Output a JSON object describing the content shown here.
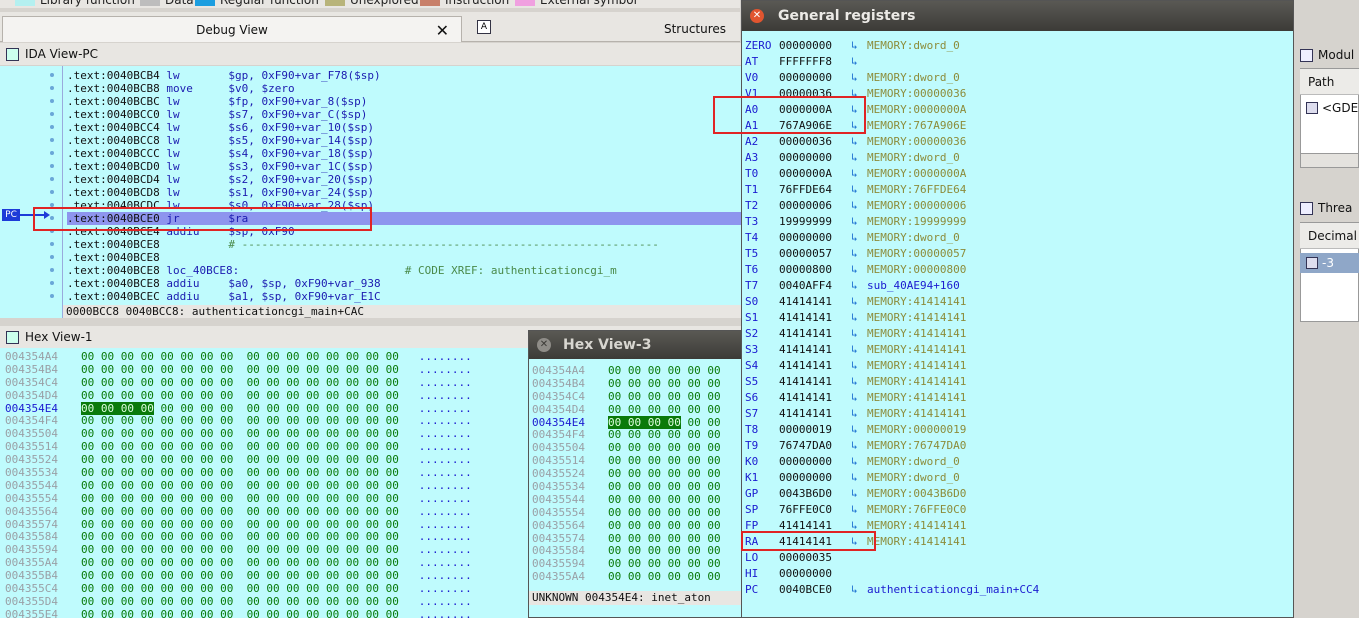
{
  "legend": [
    {
      "label": "Library function",
      "color": "#b4f0f0"
    },
    {
      "label": "Data",
      "color": "#bdbdbd"
    },
    {
      "label": "Regular function",
      "color": "#1c9ee0"
    },
    {
      "label": "Unexplored",
      "color": "#b8b47a"
    },
    {
      "label": "Instruction",
      "color": "#c8806a"
    },
    {
      "label": "External symbol",
      "color": "#f0a0e0"
    }
  ],
  "tabs": {
    "debug_view": "Debug View",
    "structures": "Structures",
    "structures_icon": "A"
  },
  "ida": {
    "title": "IDA View-PC",
    "pc_label": "PC",
    "lines": [
      {
        "addr": ".text:0040BCB4",
        "mn": "lw",
        "op": "$gp, 0xF90+var_F78($sp)"
      },
      {
        "addr": ".text:0040BCB8",
        "mn": "move",
        "op": "$v0, $zero"
      },
      {
        "addr": ".text:0040BCBC",
        "mn": "lw",
        "op": "$fp, 0xF90+var_8($sp)"
      },
      {
        "addr": ".text:0040BCC0",
        "mn": "lw",
        "op": "$s7, 0xF90+var_C($sp)"
      },
      {
        "addr": ".text:0040BCC4",
        "mn": "lw",
        "op": "$s6, 0xF90+var_10($sp)"
      },
      {
        "addr": ".text:0040BCC8",
        "mn": "lw",
        "op": "$s5, 0xF90+var_14($sp)"
      },
      {
        "addr": ".text:0040BCCC",
        "mn": "lw",
        "op": "$s4, 0xF90+var_18($sp)"
      },
      {
        "addr": ".text:0040BCD0",
        "mn": "lw",
        "op": "$s3, 0xF90+var_1C($sp)"
      },
      {
        "addr": ".text:0040BCD4",
        "mn": "lw",
        "op": "$s2, 0xF90+var_20($sp)"
      },
      {
        "addr": ".text:0040BCD8",
        "mn": "lw",
        "op": "$s1, 0xF90+var_24($sp)"
      },
      {
        "addr": ".text:0040BCDC",
        "mn": "lw",
        "op": "$s0, 0xF90+var_28($sp)"
      },
      {
        "addr": ".text:0040BCE0",
        "mn": "jr",
        "op": "$ra"
      },
      {
        "addr": ".text:0040BCE4",
        "mn": "addiu",
        "op": "$sp, 0xF90"
      },
      {
        "addr": ".text:0040BCE8",
        "mn": "",
        "op": "# ---------------------------------------------------------------"
      },
      {
        "addr": ".text:0040BCE8",
        "mn": "",
        "op": ""
      },
      {
        "addr": ".text:0040BCE8",
        "mn": "loc_40BCE8:",
        "op": "                         # CODE XREF: authenticationcgi_m"
      },
      {
        "addr": ".text:0040BCE8",
        "mn": "addiu",
        "op": "$a0, $sp, 0xF90+var_938"
      },
      {
        "addr": ".text:0040BCEC",
        "mn": "addiu",
        "op": "$a1, $sp, 0xF90+var_E1C"
      }
    ],
    "status": "0000BCC8 0040BCC8: authenticationcgi_main+CAC"
  },
  "hex1": {
    "title": "Hex View-1",
    "rows": [
      {
        "addr": "004354A4",
        "bytes": "00 00 00 00 00 00 00 00  00 00 00 00 00 00 00 00",
        "ascii": "........"
      },
      {
        "addr": "004354B4",
        "bytes": "00 00 00 00 00 00 00 00  00 00 00 00 00 00 00 00",
        "ascii": "........"
      },
      {
        "addr": "004354C4",
        "bytes": "00 00 00 00 00 00 00 00  00 00 00 00 00 00 00 00",
        "ascii": "........"
      },
      {
        "addr": "004354D4",
        "bytes": "00 00 00 00 00 00 00 00  00 00 00 00 00 00 00 00",
        "ascii": "........"
      },
      {
        "addr": "004354E4",
        "sel": "00 00 00 00",
        "bytes": " 00 00 00 00  00 00 00 00 00 00 00 00",
        "ascii": "........",
        "current": true
      },
      {
        "addr": "004354F4",
        "bytes": "00 00 00 00 00 00 00 00  00 00 00 00 00 00 00 00",
        "ascii": "........"
      },
      {
        "addr": "00435504",
        "bytes": "00 00 00 00 00 00 00 00  00 00 00 00 00 00 00 00",
        "ascii": "........"
      },
      {
        "addr": "00435514",
        "bytes": "00 00 00 00 00 00 00 00  00 00 00 00 00 00 00 00",
        "ascii": "........"
      },
      {
        "addr": "00435524",
        "bytes": "00 00 00 00 00 00 00 00  00 00 00 00 00 00 00 00",
        "ascii": "........"
      },
      {
        "addr": "00435534",
        "bytes": "00 00 00 00 00 00 00 00  00 00 00 00 00 00 00 00",
        "ascii": "........"
      },
      {
        "addr": "00435544",
        "bytes": "00 00 00 00 00 00 00 00  00 00 00 00 00 00 00 00",
        "ascii": "........"
      },
      {
        "addr": "00435554",
        "bytes": "00 00 00 00 00 00 00 00  00 00 00 00 00 00 00 00",
        "ascii": "........"
      },
      {
        "addr": "00435564",
        "bytes": "00 00 00 00 00 00 00 00  00 00 00 00 00 00 00 00",
        "ascii": "........"
      },
      {
        "addr": "00435574",
        "bytes": "00 00 00 00 00 00 00 00  00 00 00 00 00 00 00 00",
        "ascii": "........"
      },
      {
        "addr": "00435584",
        "bytes": "00 00 00 00 00 00 00 00  00 00 00 00 00 00 00 00",
        "ascii": "........"
      },
      {
        "addr": "00435594",
        "bytes": "00 00 00 00 00 00 00 00  00 00 00 00 00 00 00 00",
        "ascii": "........"
      },
      {
        "addr": "004355A4",
        "bytes": "00 00 00 00 00 00 00 00  00 00 00 00 00 00 00 00",
        "ascii": "........"
      },
      {
        "addr": "004355B4",
        "bytes": "00 00 00 00 00 00 00 00  00 00 00 00 00 00 00 00",
        "ascii": "........"
      },
      {
        "addr": "004355C4",
        "bytes": "00 00 00 00 00 00 00 00  00 00 00 00 00 00 00 00",
        "ascii": "........"
      },
      {
        "addr": "004355D4",
        "bytes": "00 00 00 00 00 00 00 00  00 00 00 00 00 00 00 00",
        "ascii": "........"
      },
      {
        "addr": "004355E4",
        "bytes": "00 00 00 00 00 00 00 00  00 00 00 00 00 00 00 00",
        "ascii": "........"
      }
    ]
  },
  "hex3": {
    "title": "Hex View-3",
    "rows": [
      {
        "addr": "004354A4",
        "bytes": "00 00 00 00 00 00"
      },
      {
        "addr": "004354B4",
        "bytes": "00 00 00 00 00 00"
      },
      {
        "addr": "004354C4",
        "bytes": "00 00 00 00 00 00"
      },
      {
        "addr": "004354D4",
        "bytes": "00 00 00 00 00 00"
      },
      {
        "addr": "004354E4",
        "sel": "00 00 00 00",
        "bytes": " 00 00",
        "current": true
      },
      {
        "addr": "004354F4",
        "bytes": "00 00 00 00 00 00"
      },
      {
        "addr": "00435504",
        "bytes": "00 00 00 00 00 00"
      },
      {
        "addr": "00435514",
        "bytes": "00 00 00 00 00 00"
      },
      {
        "addr": "00435524",
        "bytes": "00 00 00 00 00 00"
      },
      {
        "addr": "00435534",
        "bytes": "00 00 00 00 00 00"
      },
      {
        "addr": "00435544",
        "bytes": "00 00 00 00 00 00"
      },
      {
        "addr": "00435554",
        "bytes": "00 00 00 00 00 00"
      },
      {
        "addr": "00435564",
        "bytes": "00 00 00 00 00 00"
      },
      {
        "addr": "00435574",
        "bytes": "00 00 00 00 00 00"
      },
      {
        "addr": "00435584",
        "bytes": "00 00 00 00 00 00"
      },
      {
        "addr": "00435594",
        "bytes": "00 00 00 00 00 00"
      },
      {
        "addr": "004355A4",
        "bytes": "00 00 00 00 00 00"
      }
    ],
    "status": "UNKNOWN 004354E4: inet_aton"
  },
  "regs": {
    "title": "General registers",
    "rows": [
      {
        "name": "ZERO",
        "value": "00000000",
        "sym": "MEMORY:dword_0"
      },
      {
        "name": "AT",
        "value": "FFFFFFF8",
        "sym": ""
      },
      {
        "name": "V0",
        "value": "00000000",
        "sym": "MEMORY:dword_0"
      },
      {
        "name": "V1",
        "value": "00000036",
        "sym": "MEMORY:00000036"
      },
      {
        "name": "A0",
        "value": "0000000A",
        "sym": "MEMORY:0000000A"
      },
      {
        "name": "A1",
        "value": "767A906E",
        "sym": "MEMORY:767A906E"
      },
      {
        "name": "A2",
        "value": "00000036",
        "sym": "MEMORY:00000036"
      },
      {
        "name": "A3",
        "value": "00000000",
        "sym": "MEMORY:dword_0"
      },
      {
        "name": "T0",
        "value": "0000000A",
        "sym": "MEMORY:0000000A"
      },
      {
        "name": "T1",
        "value": "76FFDE64",
        "sym": "MEMORY:76FFDE64"
      },
      {
        "name": "T2",
        "value": "00000006",
        "sym": "MEMORY:00000006"
      },
      {
        "name": "T3",
        "value": "19999999",
        "sym": "MEMORY:19999999"
      },
      {
        "name": "T4",
        "value": "00000000",
        "sym": "MEMORY:dword_0"
      },
      {
        "name": "T5",
        "value": "00000057",
        "sym": "MEMORY:00000057"
      },
      {
        "name": "T6",
        "value": "00000800",
        "sym": "MEMORY:00000800"
      },
      {
        "name": "T7",
        "value": "0040AFF4",
        "sym": "sub_40AE94+160",
        "fn": true
      },
      {
        "name": "S0",
        "value": "41414141",
        "sym": "MEMORY:41414141"
      },
      {
        "name": "S1",
        "value": "41414141",
        "sym": "MEMORY:41414141"
      },
      {
        "name": "S2",
        "value": "41414141",
        "sym": "MEMORY:41414141"
      },
      {
        "name": "S3",
        "value": "41414141",
        "sym": "MEMORY:41414141"
      },
      {
        "name": "S4",
        "value": "41414141",
        "sym": "MEMORY:41414141"
      },
      {
        "name": "S5",
        "value": "41414141",
        "sym": "MEMORY:41414141"
      },
      {
        "name": "S6",
        "value": "41414141",
        "sym": "MEMORY:41414141"
      },
      {
        "name": "S7",
        "value": "41414141",
        "sym": "MEMORY:41414141"
      },
      {
        "name": "T8",
        "value": "00000019",
        "sym": "MEMORY:00000019"
      },
      {
        "name": "T9",
        "value": "76747DA0",
        "sym": "MEMORY:76747DA0"
      },
      {
        "name": "K0",
        "value": "00000000",
        "sym": "MEMORY:dword_0"
      },
      {
        "name": "K1",
        "value": "00000000",
        "sym": "MEMORY:dword_0"
      },
      {
        "name": "GP",
        "value": "0043B6D0",
        "sym": "MEMORY:0043B6D0"
      },
      {
        "name": "SP",
        "value": "76FFE0C0",
        "sym": "MEMORY:76FFE0C0"
      },
      {
        "name": "FP",
        "value": "41414141",
        "sym": "MEMORY:41414141"
      },
      {
        "name": "RA",
        "value": "41414141",
        "sym": "MEMORY:41414141"
      },
      {
        "name": "LO",
        "value": "00000035",
        "sym": "",
        "noicon": true
      },
      {
        "name": "HI",
        "value": "00000000",
        "sym": "",
        "noicon": true
      },
      {
        "name": "PC",
        "value": "0040BCE0",
        "sym": "authenticationcgi_main+CC4",
        "fn": true
      }
    ]
  },
  "right": {
    "modules_title": "Modul",
    "path_header": "Path",
    "path_row": "<GDE",
    "threads_title": "Threa",
    "decimal_header": "Decimal",
    "decimal_row": "-3"
  }
}
